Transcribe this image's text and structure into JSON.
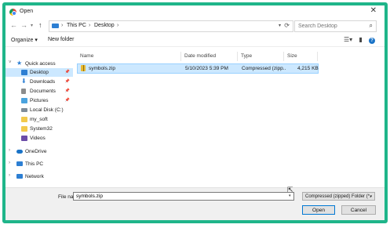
{
  "window": {
    "title": "Open"
  },
  "nav": {
    "breadcrumb": [
      "This PC",
      "Desktop"
    ],
    "search_placeholder": "Search Desktop"
  },
  "toolbar": {
    "organize": "Organize ▾",
    "new_folder": "New folder"
  },
  "sidebar": {
    "items": [
      {
        "label": "Quick access",
        "icon": "star-icon",
        "color": "#2d7fd3"
      },
      {
        "label": "Desktop",
        "icon": "desktop-icon",
        "color": "#2d7fd3",
        "selected": true,
        "pinned": true
      },
      {
        "label": "Downloads",
        "icon": "download-icon",
        "color": "#2d7fd3",
        "pinned": true
      },
      {
        "label": "Documents",
        "icon": "documents-icon",
        "color": "#8c8c8c",
        "pinned": true
      },
      {
        "label": "Pictures",
        "icon": "pictures-icon",
        "color": "#4aa3df",
        "pinned": true
      },
      {
        "label": "Local Disk (C:)",
        "icon": "disk-icon",
        "color": "#7f8c99"
      },
      {
        "label": "my_soft",
        "icon": "folder-icon",
        "color": "#f2c94c"
      },
      {
        "label": "System32",
        "icon": "folder-icon",
        "color": "#f2c94c"
      },
      {
        "label": "Videos",
        "icon": "videos-icon",
        "color": "#6b4ca8"
      },
      {
        "label": "OneDrive",
        "icon": "cloud-icon",
        "color": "#1a73c7"
      },
      {
        "label": "This PC",
        "icon": "computer-icon",
        "color": "#2d7fd3"
      },
      {
        "label": "Network",
        "icon": "network-icon",
        "color": "#2d7fd3"
      }
    ]
  },
  "table": {
    "headers": [
      "Name",
      "Date modified",
      "Type",
      "Size"
    ],
    "rows": [
      {
        "name": "symbols.zip",
        "date": "5/10/2023 5:39 PM",
        "type": "Compressed (zipp...",
        "size": "4,215 KB"
      }
    ]
  },
  "footer": {
    "file_name_label": "File name:",
    "file_name_value": "symbols.zip",
    "filter": "Compressed (zipped) Folder (*.",
    "open": "Open",
    "cancel": "Cancel"
  },
  "colors": {
    "accent": "#1fb58a",
    "selection": "#cce8ff"
  }
}
